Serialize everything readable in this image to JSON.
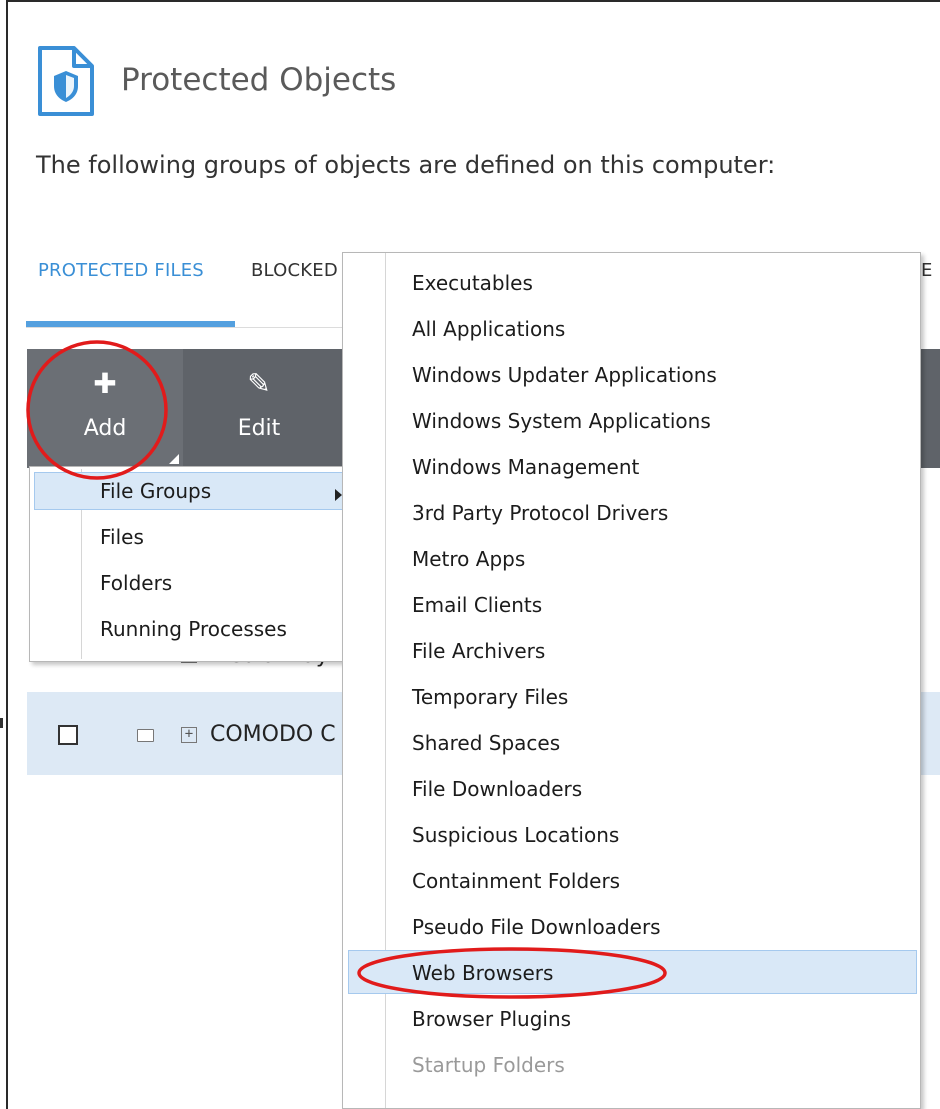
{
  "header": {
    "title": "Protected Objects",
    "subtitle": "The following groups of objects are defined on this computer:"
  },
  "tabs": [
    {
      "label": "PROTECTED FILES",
      "active": true
    },
    {
      "label": "BLOCKED"
    },
    {
      "label": "E"
    }
  ],
  "toolbar": {
    "add_label": "Add",
    "edit_label": "Edit"
  },
  "table": {
    "rows": [
      {
        "name": "Media Play",
        "checked": false
      },
      {
        "name": "COMODO C",
        "checked": false,
        "selected": true
      }
    ]
  },
  "add_menu": {
    "items": [
      {
        "label": "File Groups",
        "has_submenu": true,
        "highlighted": true
      },
      {
        "label": "Files"
      },
      {
        "label": "Folders"
      },
      {
        "label": "Running Processes"
      }
    ]
  },
  "file_groups_menu": {
    "items": [
      {
        "label": "Executables"
      },
      {
        "label": "All Applications"
      },
      {
        "label": "Windows Updater Applications"
      },
      {
        "label": "Windows System Applications"
      },
      {
        "label": "Windows Management"
      },
      {
        "label": "3rd Party Protocol Drivers"
      },
      {
        "label": "Metro Apps"
      },
      {
        "label": "Email Clients"
      },
      {
        "label": "File Archivers"
      },
      {
        "label": "Temporary Files"
      },
      {
        "label": "Shared Spaces"
      },
      {
        "label": "File Downloaders"
      },
      {
        "label": "Suspicious Locations"
      },
      {
        "label": "Containment Folders"
      },
      {
        "label": "Pseudo File Downloaders"
      },
      {
        "label": "Web Browsers",
        "highlighted": true
      },
      {
        "label": "Browser Plugins"
      },
      {
        "label": "Startup Folders",
        "disabled": true
      }
    ]
  },
  "colors": {
    "accent": "#3a8fd6",
    "toolbar_bg": "#5f6369",
    "highlight": "#d9e8f7",
    "annotation_red": "#e11b1b"
  },
  "icons": {
    "title": "shield-document-icon",
    "add": "plus-icon",
    "edit": "pencil-icon",
    "submenu": "chevron-right-icon"
  }
}
